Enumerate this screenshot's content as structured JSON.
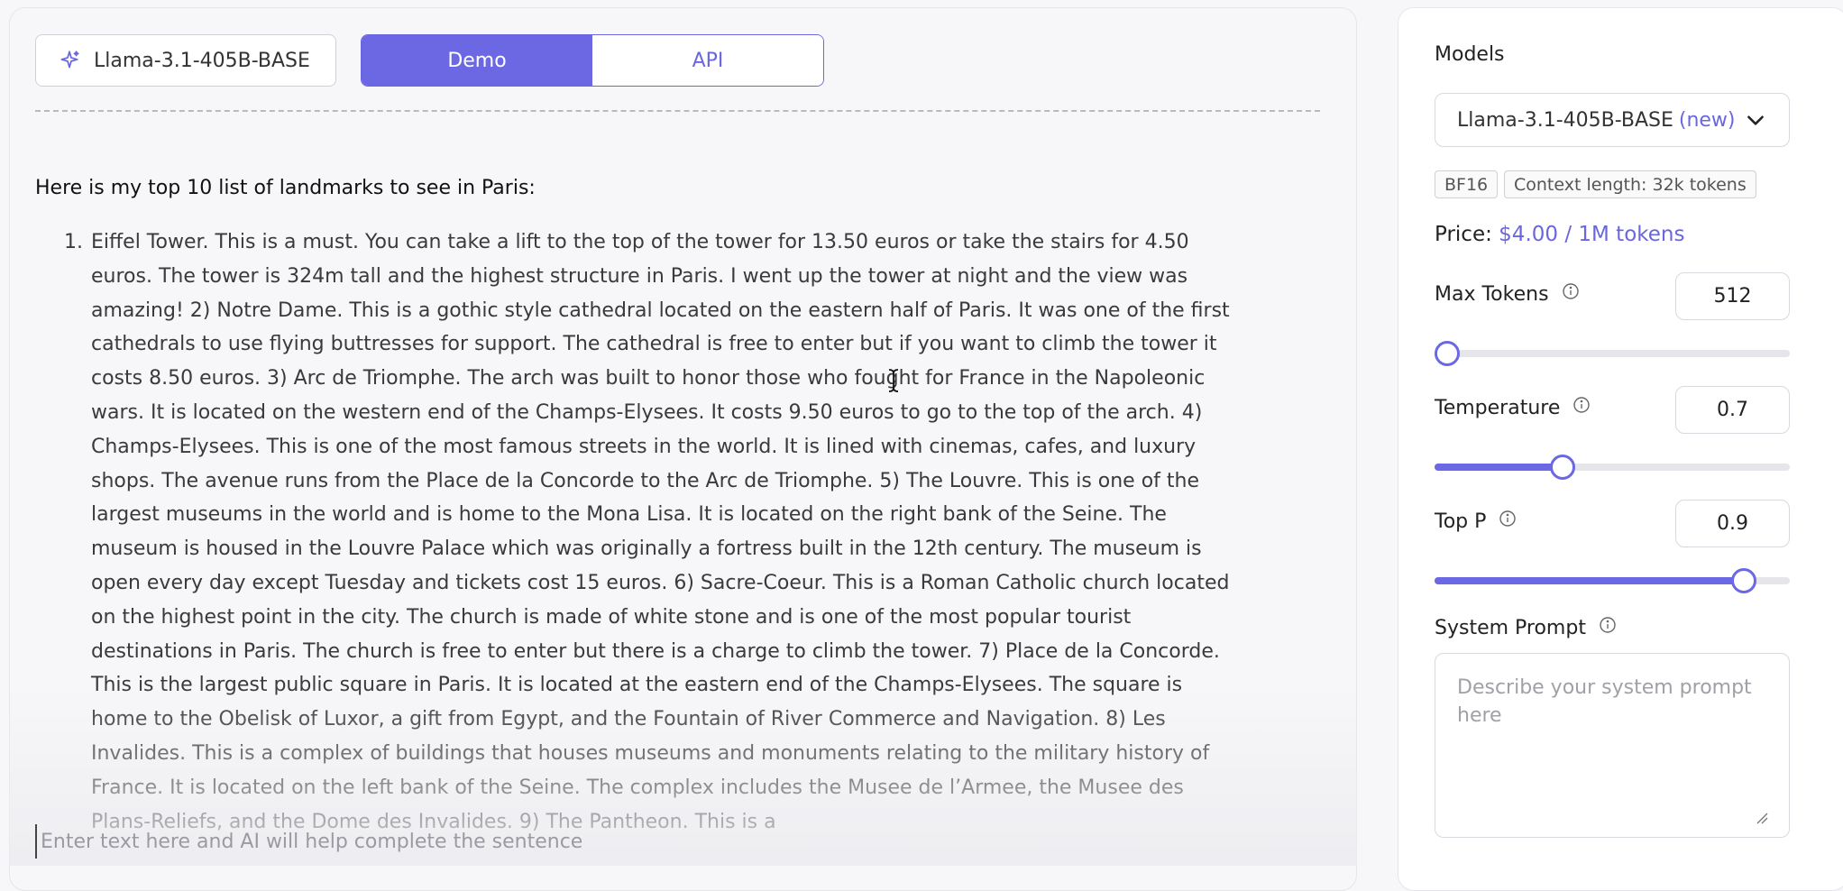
{
  "header": {
    "model_chip_label": "Llama-3.1-405B-BASE",
    "tabs": [
      {
        "label": "Demo",
        "active": true
      },
      {
        "label": "API",
        "active": false
      }
    ]
  },
  "output": {
    "intro": "Here is my top 10 list of landmarks to see in Paris:",
    "item_number": "1.",
    "item_text": "Eiffel Tower. This is a must. You can take a lift to the top of the tower for 13.50 euros or take the stairs for 4.50 euros. The tower is 324m tall and the highest structure in Paris. I went up the tower at night and the view was amazing! 2) Notre Dame. This is a gothic style cathedral located on the eastern half of Paris. It was one of the first cathedrals to use flying buttresses for support. The cathedral is free to enter but if you want to climb the tower it costs 8.50 euros. 3) Arc de Triomphe. The arch was built to honor those who fought for France in the Napoleonic wars. It is located on the western end of the Champs-Elysees. It costs 9.50 euros to go to the top of the arch. 4) Champs-Elysees. This is one of the most famous streets in the world. It is lined with cinemas, cafes, and luxury shops. The avenue runs from the Place de la Concorde to the Arc de Triomphe. 5) The Louvre. This is one of the largest museums in the world and is home to the Mona Lisa. It is located on the right bank of the Seine. The museum is housed in the Louvre Palace which was originally a fortress built in the 12th century. The museum is open every day except Tuesday and tickets cost 15 euros. 6) Sacre-Coeur. This is a Roman Catholic church located on the highest point in the city. The church is made of white stone and is one of the most popular tourist destinations in Paris. The church is free to enter but there is a charge to climb the tower. 7) Place de la Concorde. This is the largest public square in Paris. It is located at the eastern end of the Champs-Elysees. The square is home to the Obelisk of Luxor, a gift from Egypt, and the Fountain of River Commerce and Navigation. 8) Les Invalides. This is a complex of buildings that houses museums and monuments relating to the military history of France. It is located on the left bank of the Seine. The complex includes the Musee de l’Armee, the Musee des Plans-Reliefs, and the Dome des Invalides. 9) The Pantheon. This is a"
  },
  "composer": {
    "value": "",
    "placeholder": "Enter text here and AI will help complete the sentence"
  },
  "sidebar": {
    "models_title": "Models",
    "selected_model": "Llama-3.1-405B-BASE",
    "selected_model_tag": "(new)",
    "badges": [
      "BF16",
      "Context length: 32k tokens"
    ],
    "price_label": "Price:",
    "price_value": "$4.00 / 1M tokens",
    "params": [
      {
        "label": "Max Tokens",
        "value": "512",
        "level": 0.0
      },
      {
        "label": "Temperature",
        "value": "0.7",
        "level": 0.35
      },
      {
        "label": "Top P",
        "value": "0.9",
        "level": 0.9
      }
    ],
    "system_prompt_label": "System Prompt",
    "system_prompt_value": "",
    "system_prompt_placeholder": "Describe your system prompt here"
  },
  "colors": {
    "accent": "#6c68e4",
    "page_bg": "#f7f7fa",
    "panel_bg": "#ffffff"
  },
  "icons": [
    "sparkle-icon",
    "chevron-down-icon",
    "info-icon",
    "text-cursor-icon",
    "resize-grip-icon"
  ]
}
